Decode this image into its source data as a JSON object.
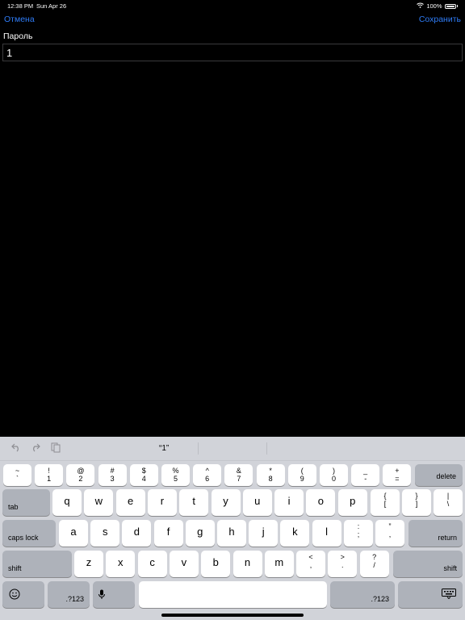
{
  "status": {
    "time": "12:38 PM",
    "date": "Sun Apr 26",
    "battery": "100%"
  },
  "nav": {
    "cancel": "Отмена",
    "save": "Сохранить"
  },
  "form": {
    "password_label": "Пароль",
    "password_value": "1"
  },
  "keyboard": {
    "suggestion": "“1”",
    "row0": [
      {
        "top": "~",
        "bot": "`"
      },
      {
        "top": "!",
        "bot": "1"
      },
      {
        "top": "@",
        "bot": "2"
      },
      {
        "top": "#",
        "bot": "3"
      },
      {
        "top": "$",
        "bot": "4"
      },
      {
        "top": "%",
        "bot": "5"
      },
      {
        "top": "^",
        "bot": "6"
      },
      {
        "top": "&",
        "bot": "7"
      },
      {
        "top": "*",
        "bot": "8"
      },
      {
        "top": "(",
        "bot": "9"
      },
      {
        "top": ")",
        "bot": "0"
      },
      {
        "top": "_",
        "bot": "-"
      },
      {
        "top": "+",
        "bot": "="
      }
    ],
    "delete": "delete",
    "tab": "tab",
    "row1": [
      "q",
      "w",
      "e",
      "r",
      "t",
      "y",
      "u",
      "i",
      "o",
      "p"
    ],
    "row1_extra": [
      {
        "top": "{",
        "bot": "["
      },
      {
        "top": "}",
        "bot": "]"
      },
      {
        "top": "|",
        "bot": "\\"
      }
    ],
    "caps_lock": "caps lock",
    "row2": [
      "a",
      "s",
      "d",
      "f",
      "g",
      "h",
      "j",
      "k",
      "l"
    ],
    "row2_extra": [
      {
        "top": ":",
        "bot": ";"
      },
      {
        "top": "”",
        "bot": ","
      }
    ],
    "return": "return",
    "shift": "shift",
    "row3": [
      "z",
      "x",
      "c",
      "v",
      "b",
      "n",
      "m"
    ],
    "row3_extra": [
      {
        "top": "<",
        "bot": ","
      },
      {
        "top": ">",
        "bot": "."
      },
      {
        "top": "?",
        "bot": "/"
      }
    ],
    "numbers": ".?123"
  }
}
